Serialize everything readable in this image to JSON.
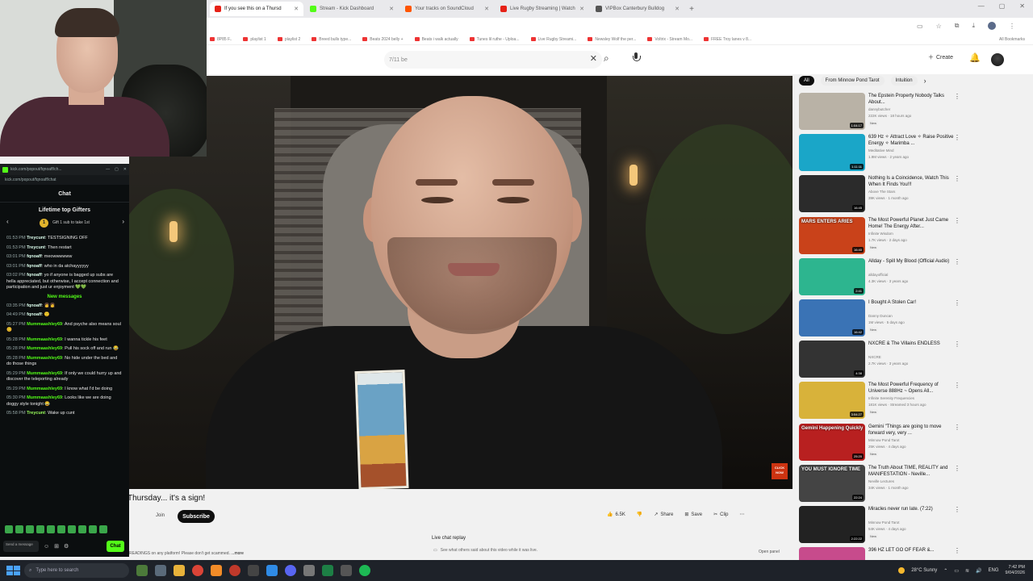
{
  "browser": {
    "tabs": [
      {
        "label": "If you see this on a Thursd",
        "active": true,
        "color": "#e62117"
      },
      {
        "label": "Stream - Kick Dashboard",
        "active": false,
        "color": "#53fc18"
      },
      {
        "label": "Your tracks on SoundCloud",
        "active": false,
        "color": "#ff5500"
      },
      {
        "label": "Live Rugby Streaming | Watch",
        "active": false,
        "color": "#e62117"
      },
      {
        "label": "VIPBox Canterbury Bulldog",
        "active": false,
        "color": "#555555"
      }
    ],
    "new_tab": "+",
    "bookmarks": [
      "8P85 F..",
      "playlist 1",
      "playlist 2",
      "Breed bulls type...",
      "Beats 2024 belly +",
      "Beats i walk actually",
      "Tunes lil ruthe - Uploa...",
      "Live Rugby Streami...",
      "Newsley Wolf the per...",
      "Voltrix - Stream Mo...",
      "FREE Troy lanes v 8..."
    ],
    "all_bookmarks": "All Bookmarks"
  },
  "youtube": {
    "search_value": "7/11 be",
    "create_label": "Create",
    "video_title": "Thursday... it's a sign!",
    "join_label": "Join",
    "subscribe_label": "Subscribe",
    "likes": "6.5K",
    "share_label": "Share",
    "save_label": "Save",
    "clip_label": "Clip",
    "live_chat_replay": "Live chat replay",
    "live_chat_desc": "See what others said about this video while it was live.",
    "open_panel": "Open panel",
    "description": "READINGS on any platform! Please don't get scammed.",
    "more_label": "...more",
    "click_now": "CLICK NOW"
  },
  "chips": [
    "All",
    "From Minnow Pond Tarot",
    "Intuition"
  ],
  "recommendations": [
    {
      "title": "The Epstein Property Nobody Talks About...",
      "channel": "dannybutcher",
      "meta": "222K views · 18 hours ago",
      "duration": "1:04:17",
      "new": "New",
      "bg": "#b9b2a6"
    },
    {
      "title": "639 Hz ✧ Attract Love ✧ Raise Positive Energy ✧ Marimba ...",
      "channel": "Meditative Mind",
      "meta": "1.9M views · 2 years ago",
      "duration": "1:11:11",
      "new": "",
      "bg": "#1aa6c8"
    },
    {
      "title": "Nothing Is a Coincidence, Watch This When It Finds You!!!",
      "channel": "Above The Stars",
      "meta": "39K views · 1 month ago",
      "duration": "16:45",
      "new": "",
      "bg": "#2b2b2b"
    },
    {
      "title": "The Most Powerful Planet Just Came Home! The Energy After...",
      "channel": "Infinite Wisdom",
      "meta": "1.7K views · 2 days ago",
      "duration": "16:40",
      "new": "New",
      "bg": "#c9421a",
      "thumb_text": "MARS ENTERS ARIES"
    },
    {
      "title": "Allday - Spill My Blood (Official Audio)",
      "channel": "alldayofficial",
      "meta": "4.3K views · 3 years ago",
      "duration": "2:41",
      "new": "",
      "bg": "#2db58f"
    },
    {
      "title": "I Bought A Stolen Car!",
      "channel": "Danny Duncan",
      "meta": "1M views · 5 days ago",
      "duration": "16:42",
      "new": "New",
      "bg": "#3a73b5"
    },
    {
      "title": "NXCRE & The Villains ENDLESS",
      "channel": "NXCRE",
      "meta": "2.7K views · 3 years ago",
      "duration": "4:38",
      "new": "",
      "bg": "#333333"
    },
    {
      "title": "The Most Powerful Frequency of Universe 888Hz ~ Opens All...",
      "channel": "Infinite Serenity Frequencies",
      "meta": "181K views · Streamed 3 hours ago",
      "duration": "3:54:27",
      "new": "New",
      "bg": "#d8b23a"
    },
    {
      "title": "Gemini \"Things are going to move forward very, very ...",
      "channel": "Minnow Pond Tarot",
      "meta": "25K views · 4 days ago",
      "duration": "25:20",
      "new": "New",
      "bg": "#b82020",
      "thumb_text": "Gemini Happening Quickly"
    },
    {
      "title": "The Truth About TIME, REALITY and MANIFESTATION - Neville...",
      "channel": "Neville Lectures",
      "meta": "34K views · 1 month ago",
      "duration": "22:24",
      "new": "",
      "bg": "#444444",
      "thumb_text": "YOU MUST IGNORE TIME"
    },
    {
      "title": "Miracles never run late. (7:22)",
      "channel": "Minnow Pond Tarot",
      "meta": "54K views · 4 days ago",
      "duration": "2:22:22",
      "new": "New",
      "bg": "#222222"
    },
    {
      "title": "396 HZ LET GO OF FEAR &...",
      "channel": "",
      "meta": "",
      "duration": "",
      "new": "",
      "bg": "#c74b8c"
    }
  ],
  "kick": {
    "title_url": "kick.com/popout/fqnoaff/ch...",
    "address": "kick.com/popout/fqnoaff/chat",
    "chat_label": "Chat",
    "gifters_title": "Lifetime top Gifters",
    "gift_prompt": "Gift 1 sub to take 1st",
    "new_messages": "New messages",
    "messages_before": [
      {
        "time": "01:53 PM",
        "user": "Treycunt",
        "color": "white",
        "text": "TESTSIGNING OFF"
      },
      {
        "time": "01:53 PM",
        "user": "Treycunt",
        "color": "white",
        "text": "Then restart"
      },
      {
        "time": "03:01 PM",
        "user": "fqnoaff",
        "color": "white",
        "text": "meowwwwww"
      },
      {
        "time": "03:01 PM",
        "user": "fqnoaff",
        "color": "white",
        "text": "who in da atchayyyyyy"
      },
      {
        "time": "03:02 PM",
        "user": "fqnoaff",
        "color": "white",
        "text": "yo if anyone is bagged up subs are hella appreciated, but otherwise, I accept connection and participation and just ur enjoyment 💚💚"
      }
    ],
    "messages_after": [
      {
        "time": "03:35 PM",
        "user": "fqnoaff",
        "color": "white",
        "text": "👩👩"
      },
      {
        "time": "04:49 PM",
        "user": "fqnoaff",
        "color": "white",
        "text": "🙂"
      },
      {
        "time": "05:27 PM",
        "user": "Mummaashley69",
        "color": "green",
        "text": "And psyche also means soul 😊"
      },
      {
        "time": "05:28 PM",
        "user": "Mummaashley69",
        "color": "green",
        "text": "I wanna tickle his feet"
      },
      {
        "time": "05:28 PM",
        "user": "Mummaashley69",
        "color": "green",
        "text": "Pull his sock off and run 😂"
      },
      {
        "time": "05:28 PM",
        "user": "Mummaashley69",
        "color": "green",
        "text": "No hide under the bed and do those things"
      },
      {
        "time": "05:29 PM",
        "user": "Mummaashley69",
        "color": "green",
        "text": "If only we could hurry up and discover the teleporting already"
      },
      {
        "time": "05:29 PM",
        "user": "Mummaashley69",
        "color": "green",
        "text": "I know what I'd be doing"
      },
      {
        "time": "05:30 PM",
        "user": "Mummaashley69",
        "color": "green",
        "text": "Looks like we are doing doggy style tonight 😂"
      },
      {
        "time": "05:58 PM",
        "user": "Treycunt",
        "color": "lime",
        "text": "Wake up cunt"
      }
    ],
    "send_placeholder": "Send a message",
    "chat_button": "Chat"
  },
  "taskbar": {
    "search_placeholder": "Type here to search",
    "weather": "28°C Sunny",
    "lang": "ENG",
    "time": "7:42 PM",
    "date": "9/04/2026"
  }
}
